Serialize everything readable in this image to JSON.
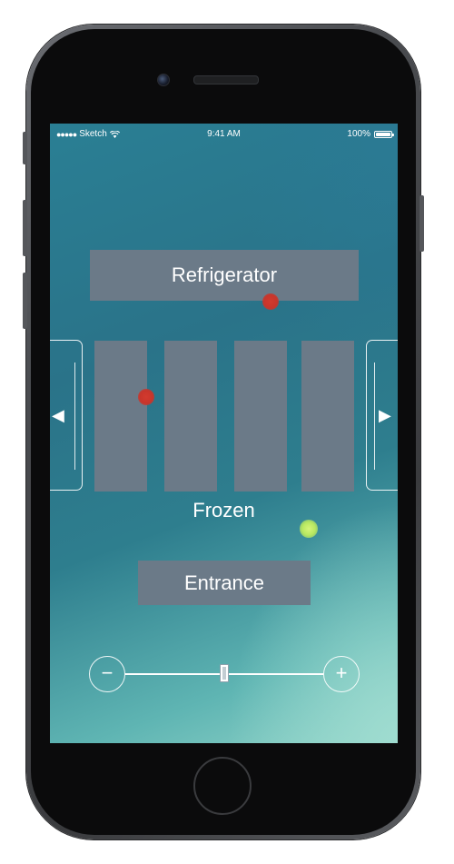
{
  "status_bar": {
    "signal": "●●●●●",
    "carrier": "Sketch",
    "time": "9:41 AM",
    "battery_text": "100%",
    "battery_level": 1.0,
    "wifi_icon": "wifi-icon"
  },
  "panels": {
    "refrigerator_label": "Refrigerator",
    "frozen_label": "Frozen",
    "entrance_label": "Entrance"
  },
  "nav": {
    "left_arrow": "◀",
    "right_arrow": "▶"
  },
  "slider": {
    "minus_label": "−",
    "plus_label": "+",
    "value": 0.5
  },
  "colors": {
    "panel": "#6b7a88",
    "marker_red": "#c8352b",
    "marker_green": "#b8e860",
    "screen_top": "#2a7f94",
    "screen_bottom": "#8fd3c8"
  }
}
